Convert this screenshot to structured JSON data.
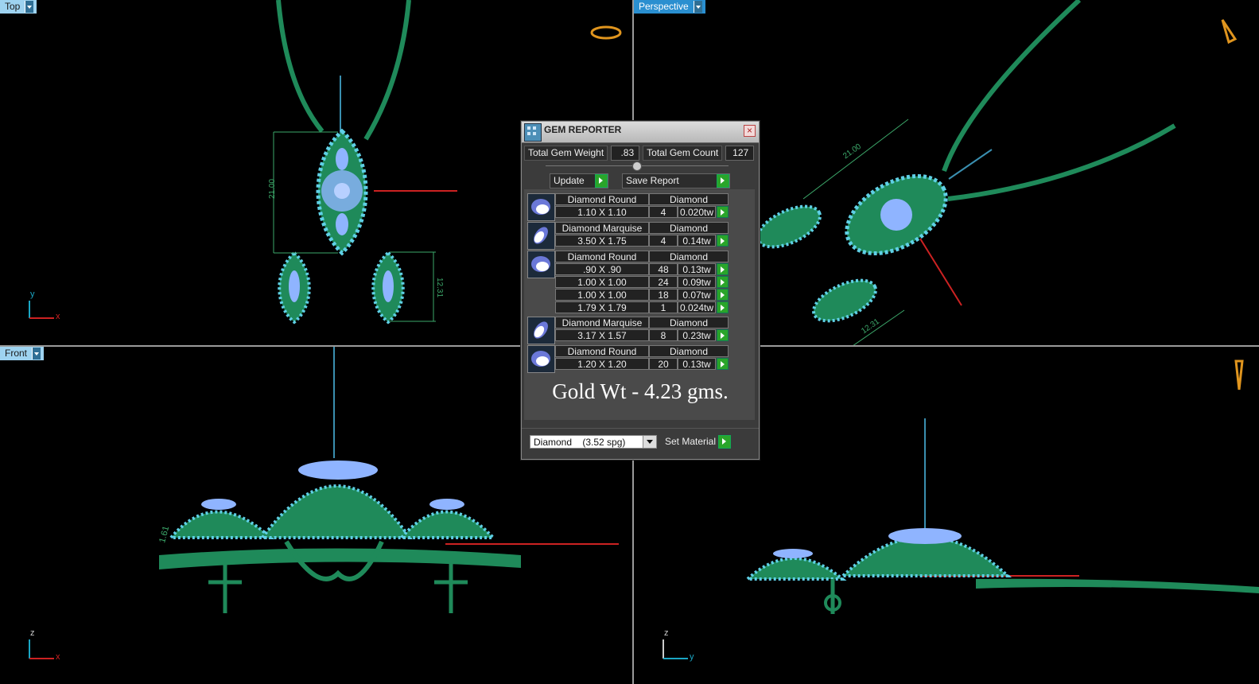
{
  "viewports": {
    "top": {
      "label": "Top"
    },
    "perspective": {
      "label": "Perspective"
    },
    "front": {
      "label": "Front"
    }
  },
  "dimensions": {
    "pendant_height": "21.00",
    "earring_height": "12.31",
    "front_thickness": "1.61",
    "persp_pendant": "21.00",
    "persp_earring": "12.31"
  },
  "axes": {
    "top": [
      "y",
      "x"
    ],
    "front": [
      "z",
      "x"
    ],
    "right": [
      "z",
      "y"
    ]
  },
  "colors": {
    "metal": "#1f8a5a",
    "gem": "#7fd7ee",
    "gem_center": "#8fb4ff",
    "axis_x": "#c22",
    "axis_y": "#1aa6c4"
  },
  "gem_reporter": {
    "title": "GEM REPORTER",
    "total_gem_weight_label": "Total Gem Weight",
    "total_gem_weight": ".83",
    "total_gem_count_label": "Total Gem Count",
    "total_gem_count": "127",
    "update_label": "Update",
    "save_report_label": "Save Report",
    "groups": [
      {
        "shape": "Diamond Round",
        "material": "Diamond",
        "rows": [
          {
            "size": "1.10 X 1.10",
            "count": "4",
            "weight": "0.020tw"
          }
        ]
      },
      {
        "shape": "Diamond Marquise",
        "material": "Diamond",
        "rows": [
          {
            "size": "3.50 X 1.75",
            "count": "4",
            "weight": "0.14tw"
          }
        ]
      },
      {
        "shape": "Diamond Round",
        "material": "Diamond",
        "rows": [
          {
            "size": ".90 X .90",
            "count": "48",
            "weight": "0.13tw"
          },
          {
            "size": "1.00 X 1.00",
            "count": "24",
            "weight": "0.09tw"
          },
          {
            "size": "1.00 X 1.00",
            "count": "18",
            "weight": "0.07tw"
          },
          {
            "size": "1.79 X 1.79",
            "count": "1",
            "weight": "0.024tw"
          }
        ]
      },
      {
        "shape": "Diamond Marquise",
        "material": "Diamond",
        "rows": [
          {
            "size": "3.17 X 1.57",
            "count": "8",
            "weight": "0.23tw"
          }
        ]
      },
      {
        "shape": "Diamond Round",
        "material": "Diamond",
        "rows": [
          {
            "size": "1.20 X 1.20",
            "count": "20",
            "weight": "0.13tw"
          }
        ]
      }
    ],
    "gold_weight": "Gold Wt - 4.23 gms.",
    "material_select": "Diamond    (3.52 spg)",
    "set_material_label": "Set Material"
  }
}
